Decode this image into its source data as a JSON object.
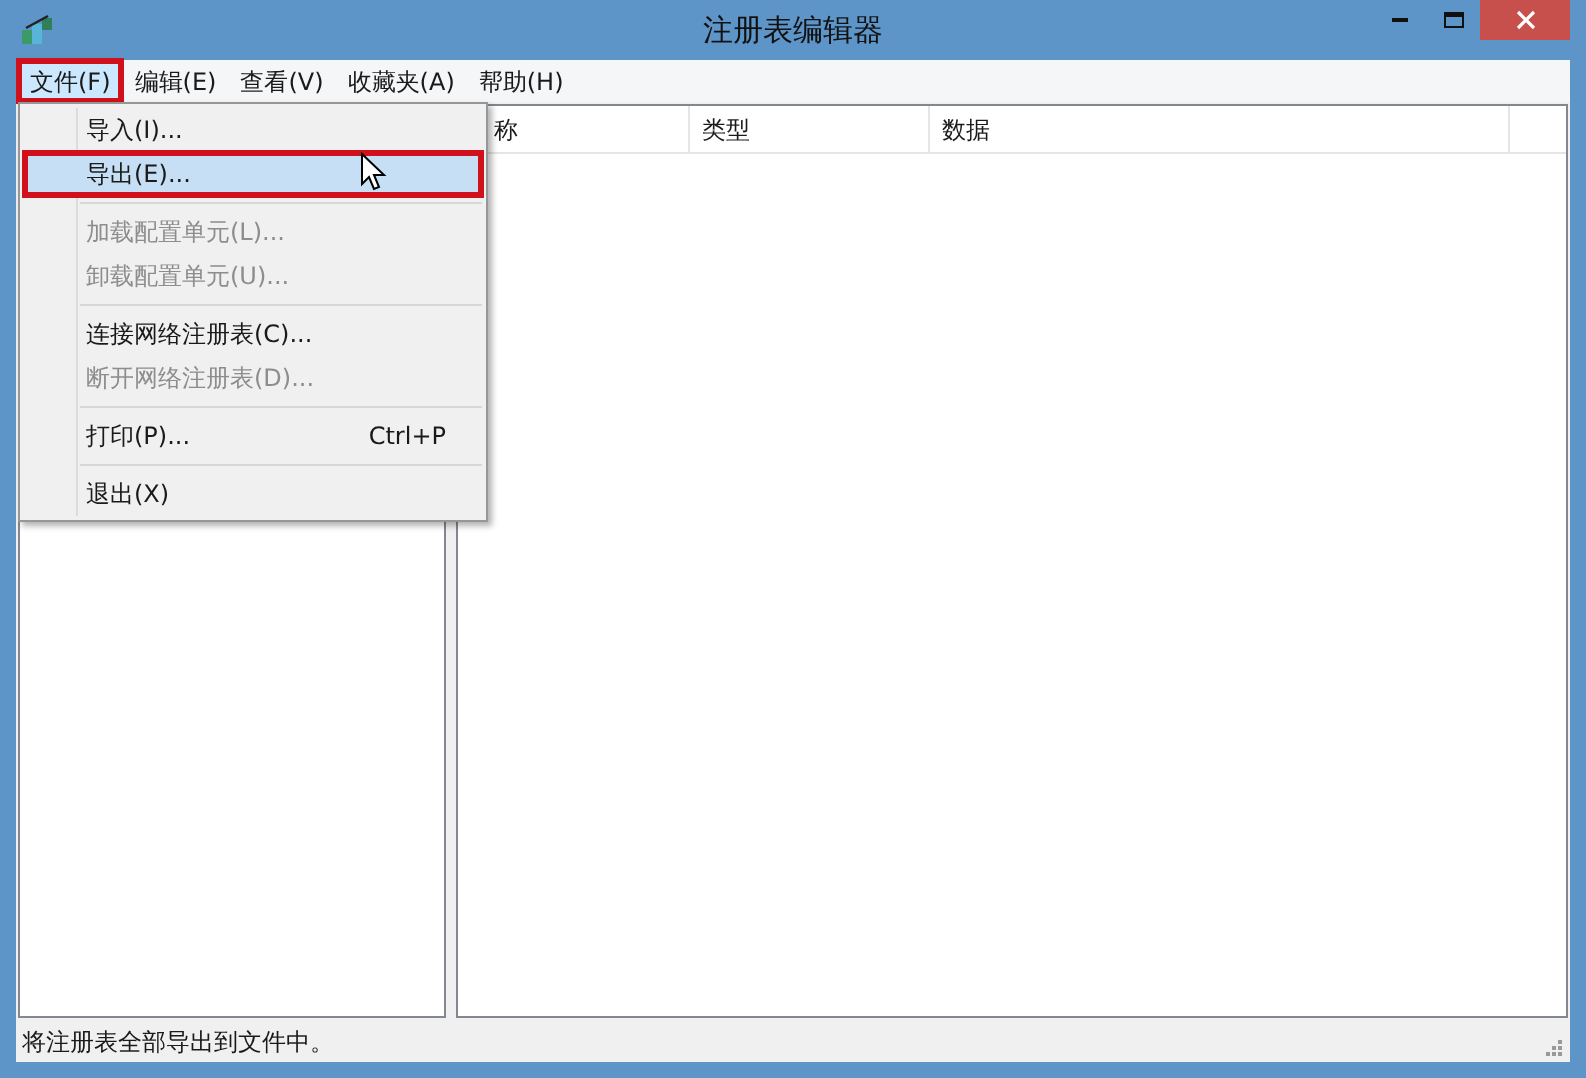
{
  "window": {
    "title": "注册表编辑器"
  },
  "menu_bar": [
    {
      "label": "文件(F)",
      "selected": true,
      "highlighted": true
    },
    {
      "label": "编辑(E)",
      "selected": false,
      "highlighted": false
    },
    {
      "label": "查看(V)",
      "selected": false,
      "highlighted": false
    },
    {
      "label": "收藏夹(A)",
      "selected": false,
      "highlighted": false
    },
    {
      "label": "帮助(H)",
      "selected": false,
      "highlighted": false
    }
  ],
  "file_menu": [
    {
      "kind": "item",
      "label": "导入(I)...",
      "disabled": false,
      "selected": false,
      "highlighted": false
    },
    {
      "kind": "item",
      "label": "导出(E)...",
      "disabled": false,
      "selected": true,
      "highlighted": true
    },
    {
      "kind": "separator"
    },
    {
      "kind": "item",
      "label": "加载配置单元(L)...",
      "disabled": true,
      "selected": false,
      "highlighted": false
    },
    {
      "kind": "item",
      "label": "卸载配置单元(U)...",
      "disabled": true,
      "selected": false,
      "highlighted": false
    },
    {
      "kind": "separator"
    },
    {
      "kind": "item",
      "label": "连接网络注册表(C)...",
      "disabled": false,
      "selected": false,
      "highlighted": false
    },
    {
      "kind": "item",
      "label": "断开网络注册表(D)...",
      "disabled": true,
      "selected": false,
      "highlighted": false
    },
    {
      "kind": "separator"
    },
    {
      "kind": "item",
      "label": "打印(P)...",
      "shortcut": "Ctrl+P",
      "disabled": false,
      "selected": false,
      "highlighted": false
    },
    {
      "kind": "separator"
    },
    {
      "kind": "item",
      "label": "退出(X)",
      "disabled": false,
      "selected": false,
      "highlighted": false
    }
  ],
  "list": {
    "columns": [
      "称",
      "类型",
      "数据"
    ]
  },
  "status_bar": "将注册表全部导出到文件中。"
}
